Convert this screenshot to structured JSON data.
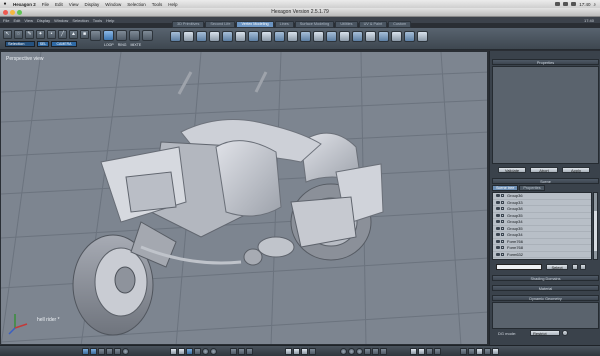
{
  "menubar": {
    "apple": "",
    "items": [
      "Hexagon 2",
      "File",
      "Edit",
      "View",
      "Display",
      "Window",
      "Selection",
      "Tools",
      "Help"
    ],
    "clock": "17:40"
  },
  "window": {
    "title": "Hexagon Version 2.5.1.79"
  },
  "mode_tabs": [
    "3D Primitives",
    "Second Life",
    "Vertex Modeling",
    "Lines",
    "Surface Modeling",
    "Utilities",
    "UV & Paint",
    "Custom"
  ],
  "active_mode_tab": "Vertex Modeling",
  "toolbar": {
    "selection_label": "Selection",
    "selection_extra_1": "SEL",
    "selection_extra_2": "CAMERA",
    "group2_labels": [
      "LOOP",
      "RING",
      "MIXTE"
    ]
  },
  "viewport": {
    "label": "Perspective view",
    "scene_label": "hell rider *",
    "colors": {
      "background": "#7d8590",
      "grid": "#6a737e",
      "model": "#c4c7cf"
    }
  },
  "right_panel": {
    "properties_title": "Properties",
    "buttons": {
      "validate": "Validate",
      "abort": "Abort",
      "apply": "Apply"
    },
    "scene_title": "Scene",
    "scene_tabs": [
      "Scene tree",
      "Properties"
    ],
    "tree_items": [
      "Group36",
      "Group33",
      "Group38",
      "Group35",
      "Group34",
      "Group35",
      "Group34",
      "Form766",
      "Form768",
      "Form632"
    ],
    "select_button": "Select",
    "shading_title": "Shading Domains",
    "material_title": "Material",
    "dg_title": "Dynamic Geometry",
    "dg_mode_label": "DG mode:",
    "dg_mode_value": "Restrict"
  }
}
